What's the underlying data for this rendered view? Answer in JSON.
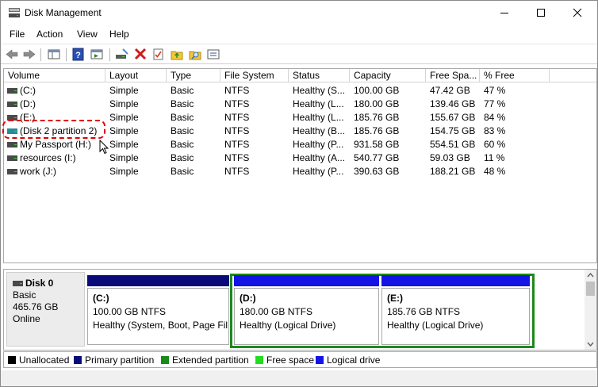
{
  "window": {
    "title": "Disk Management"
  },
  "menu": [
    "File",
    "Action",
    "View",
    "Help"
  ],
  "toolbar_icons": [
    "back-arrow-icon",
    "forward-arrow-icon",
    "console-tree-icon",
    "help-icon",
    "action-pane-icon",
    "connect-disk-icon",
    "delete-icon",
    "checklist-icon",
    "folder-up-icon",
    "search-folder-icon",
    "properties-icon"
  ],
  "columns": [
    "Volume",
    "Layout",
    "Type",
    "File System",
    "Status",
    "Capacity",
    "Free Spa...",
    "% Free"
  ],
  "volumes": [
    {
      "volume": "(C:)",
      "layout": "Simple",
      "type": "Basic",
      "fs": "NTFS",
      "status": "Healthy (S...",
      "capacity": "100.00 GB",
      "free": "47.42 GB",
      "pct": "47 %"
    },
    {
      "volume": "(D:)",
      "layout": "Simple",
      "type": "Basic",
      "fs": "NTFS",
      "status": "Healthy (L...",
      "capacity": "180.00 GB",
      "free": "139.46 GB",
      "pct": "77 %"
    },
    {
      "volume": "(E:)",
      "layout": "Simple",
      "type": "Basic",
      "fs": "NTFS",
      "status": "Healthy (L...",
      "capacity": "185.76 GB",
      "free": "155.67 GB",
      "pct": "84 %"
    },
    {
      "volume": "(Disk 2 partition 2)",
      "layout": "Simple",
      "type": "Basic",
      "fs": "NTFS",
      "status": "Healthy (B...",
      "capacity": "185.76 GB",
      "free": "154.75 GB",
      "pct": "83 %"
    },
    {
      "volume": "My Passport (H:)",
      "layout": "Simple",
      "type": "Basic",
      "fs": "NTFS",
      "status": "Healthy (P...",
      "capacity": "931.58 GB",
      "free": "554.51 GB",
      "pct": "60 %"
    },
    {
      "volume": "resources (I:)",
      "layout": "Simple",
      "type": "Basic",
      "fs": "NTFS",
      "status": "Healthy (A...",
      "capacity": "540.77 GB",
      "free": "59.03 GB",
      "pct": "11 %"
    },
    {
      "volume": "work (J:)",
      "layout": "Simple",
      "type": "Basic",
      "fs": "NTFS",
      "status": "Healthy (P...",
      "capacity": "390.63 GB",
      "free": "188.21 GB",
      "pct": "48 %"
    }
  ],
  "disk0": {
    "name": "Disk 0",
    "type": "Basic",
    "size": "465.76 GB",
    "state": "Online",
    "partitions": [
      {
        "name": "(C:)",
        "size": "100.00 GB NTFS",
        "status": "Healthy (System, Boot, Page Fil"
      },
      {
        "name": "(D:)",
        "size": "180.00 GB NTFS",
        "status": "Healthy (Logical Drive)"
      },
      {
        "name": "(E:)",
        "size": "185.76 GB NTFS",
        "status": "Healthy (Logical Drive)"
      }
    ]
  },
  "legend": [
    {
      "label": "Unallocated",
      "color": "#000000"
    },
    {
      "label": "Primary partition",
      "color": "#0a0a78"
    },
    {
      "label": "Extended partition",
      "color": "#1b8a1b"
    },
    {
      "label": "Free space",
      "color": "#22dd22"
    },
    {
      "label": "Logical drive",
      "color": "#1414e6"
    }
  ],
  "colors": {
    "primary": "#0a0a78",
    "logical": "#1414e6",
    "extended": "#1b8a1b",
    "highlight": "#e00000"
  }
}
